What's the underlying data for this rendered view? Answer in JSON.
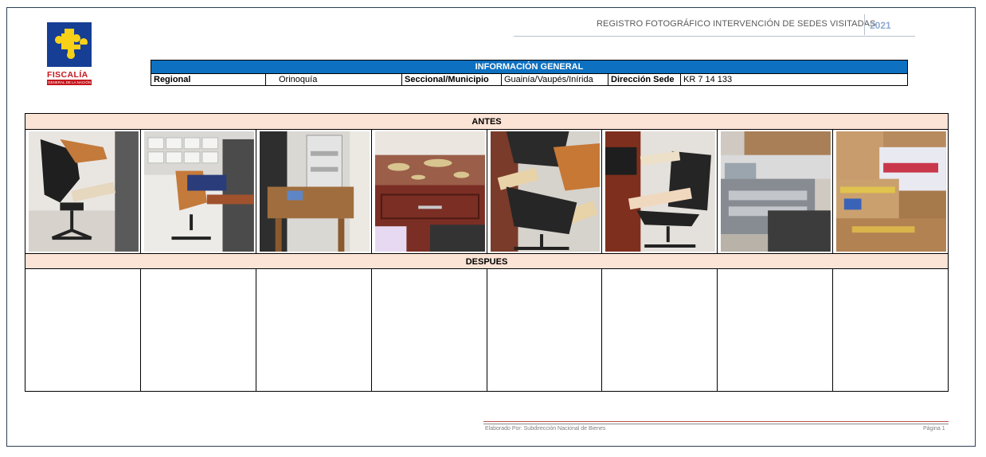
{
  "logo": {
    "name": "FISCALÍA",
    "subtitle": "GENERAL DE LA NACIÓN",
    "colors": {
      "blue": "#163e95",
      "yellow": "#f7d117",
      "red": "#c6151d"
    }
  },
  "header": {
    "title": "REGISTRO FOTOGRÁFICO INTERVENCIÓN DE SEDES VISITADAS",
    "year": "2021"
  },
  "info_general": {
    "heading": "INFORMACIÓN GENERAL",
    "regional_label": "Regional",
    "regional_value": "Orinoquía",
    "seccional_label": "Seccional/Municipio",
    "seccional_value": "Guainía/Vaupés/Inírida",
    "direccion_label": "Dirección Sede",
    "direccion_value": "KR 7 14 133",
    "header_color": "#0d70c0"
  },
  "sections": {
    "antes_label": "ANTES",
    "despues_label": "DESPUES",
    "band_color": "#fbe3d5"
  },
  "antes_photos": [
    {
      "icon": "office-chair-photo"
    },
    {
      "icon": "office-chair-desk-photo"
    },
    {
      "icon": "printer-on-table-photo"
    },
    {
      "icon": "damaged-cabinet-photo"
    },
    {
      "icon": "worn-chair-photo"
    },
    {
      "icon": "chair-keyboard-photo"
    },
    {
      "icon": "photocopier-photo"
    },
    {
      "icon": "cardboard-boxes-photo"
    }
  ],
  "despues_cells": 8,
  "footer": {
    "prepared_by": "Elaborado Por: Subdirección Nacional de Bienes",
    "page": "Página 1"
  }
}
